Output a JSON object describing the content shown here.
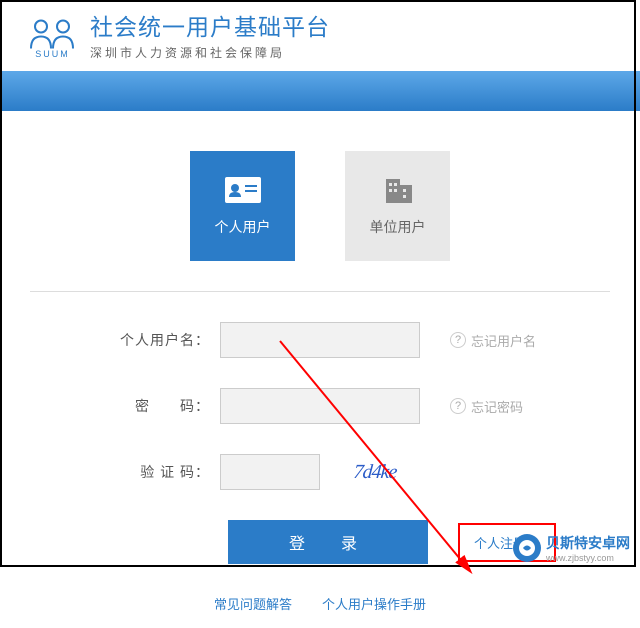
{
  "header": {
    "logo_text": "SUUM",
    "title": "社会统一用户基础平台",
    "subtitle": "深圳市人力资源和社会保障局"
  },
  "tabs": {
    "personal": "个人用户",
    "org": "单位用户"
  },
  "form": {
    "username_label": "个人用户名：",
    "password_label": "密　　码：",
    "captcha_label": "验 证 码：",
    "captcha_value": "7d4ke",
    "forgot_username": "忘记用户名",
    "forgot_password": "忘记密码",
    "login_button": "登　录",
    "register_link": "个人注册"
  },
  "footer": {
    "faq": "常见问题解答",
    "manual": "个人用户操作手册"
  },
  "watermark": {
    "name": "贝斯特安卓网",
    "url": "www.zjbstyy.com"
  }
}
